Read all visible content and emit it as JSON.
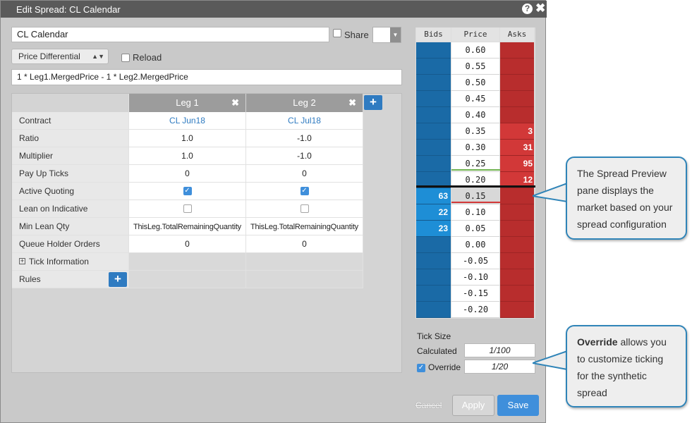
{
  "dialog": {
    "title": "Edit Spread: CL Calendar",
    "help_icon": "?",
    "close_icon": "✖"
  },
  "form": {
    "name_value": "CL Calendar",
    "share_label": "Share",
    "share_checked": false,
    "type_value": "Price Differential",
    "reload_label": "Reload",
    "reload_checked": false,
    "formula": "1 * Leg1.MergedPrice - 1 * Leg2.MergedPrice"
  },
  "grid": {
    "legs": [
      {
        "label": "Leg 1",
        "close_icon": "✖"
      },
      {
        "label": "Leg 2",
        "close_icon": "✖"
      }
    ],
    "add_leg_icon": "+",
    "rows": [
      {
        "label": "Contract",
        "values": [
          "CL Jun18",
          "CL Jul18"
        ],
        "kind": "link"
      },
      {
        "label": "Ratio",
        "values": [
          "1.0",
          "-1.0"
        ],
        "kind": "text"
      },
      {
        "label": "Multiplier",
        "values": [
          "1.0",
          "-1.0"
        ],
        "kind": "text"
      },
      {
        "label": "Pay Up Ticks",
        "values": [
          "0",
          "0"
        ],
        "kind": "text"
      },
      {
        "label": "Active Quoting",
        "values": [
          "checked",
          "checked"
        ],
        "kind": "checkbox"
      },
      {
        "label": "Lean on Indicative",
        "values": [
          "unchecked",
          "unchecked"
        ],
        "kind": "checkbox"
      },
      {
        "label": "Min Lean Qty",
        "values": [
          "ThisLeg.TotalRemainingQuantity",
          "ThisLeg.TotalRemainingQuantity"
        ],
        "kind": "text"
      },
      {
        "label": "Queue Holder Orders",
        "values": [
          "0",
          "0"
        ],
        "kind": "text"
      }
    ],
    "tick_info_label": "Tick Information",
    "expand_icon": "+",
    "rules_label": "Rules",
    "add_rule_icon": "+"
  },
  "ladder": {
    "headers": {
      "bids": "Bids",
      "price": "Price",
      "asks": "Asks"
    },
    "rows": [
      {
        "price": "0.60",
        "bid": "",
        "ask": ""
      },
      {
        "price": "0.55",
        "bid": "",
        "ask": ""
      },
      {
        "price": "0.50",
        "bid": "",
        "ask": ""
      },
      {
        "price": "0.45",
        "bid": "",
        "ask": ""
      },
      {
        "price": "0.40",
        "bid": "",
        "ask": ""
      },
      {
        "price": "0.35",
        "bid": "",
        "ask": "3"
      },
      {
        "price": "0.30",
        "bid": "",
        "ask": "31"
      },
      {
        "price": "0.25",
        "bid": "",
        "ask": "95"
      },
      {
        "price": "0.20",
        "bid": "",
        "ask": "12"
      },
      {
        "price": "0.15",
        "bid": "63",
        "ask": ""
      },
      {
        "price": "0.10",
        "bid": "22",
        "ask": ""
      },
      {
        "price": "0.05",
        "bid": "23",
        "ask": ""
      },
      {
        "price": "0.00",
        "bid": "",
        "ask": ""
      },
      {
        "price": "-0.05",
        "bid": "",
        "ask": ""
      },
      {
        "price": "-0.10",
        "bid": "",
        "ask": ""
      },
      {
        "price": "-0.15",
        "bid": "",
        "ask": ""
      },
      {
        "price": "-0.20",
        "bid": "",
        "ask": ""
      }
    ]
  },
  "tick_size": {
    "label": "Tick Size",
    "calculated_label": "Calculated",
    "calculated_value": "1/100",
    "override_label": "Override",
    "override_checked": true,
    "override_value": "1/20"
  },
  "buttons": {
    "cancel": "Cancel",
    "apply": "Apply",
    "save": "Save"
  },
  "callouts": {
    "preview_text": "The Spread Preview pane displays the market based on your spread configuration",
    "override_bold": "Override",
    "override_text": " allows you to customize ticking for the synthetic spread"
  },
  "colors": {
    "accent": "#3f8fdb",
    "bid": "#1a6aa6",
    "bid_lit": "#1e8ed6",
    "ask": "#b82d2d",
    "ask_lit": "#d23838",
    "callout_border": "#2f84b8"
  }
}
